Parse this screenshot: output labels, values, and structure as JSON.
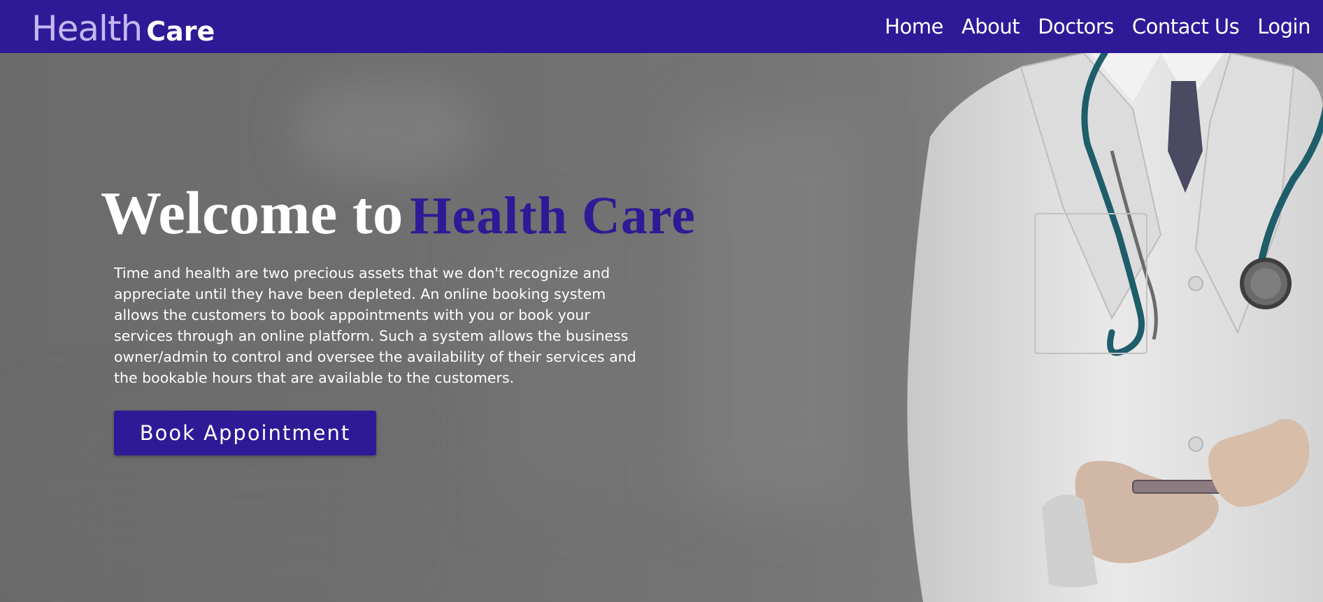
{
  "brand": {
    "light": "Health",
    "bold": "Care"
  },
  "nav": {
    "items": [
      {
        "label": "Home"
      },
      {
        "label": "About"
      },
      {
        "label": "Doctors"
      },
      {
        "label": "Contact Us"
      },
      {
        "label": "Login"
      }
    ]
  },
  "hero": {
    "title_white": "Welcome to",
    "title_accent": "Health Care",
    "description": "Time and health are two precious assets that we don't recognize and appreciate until they have been depleted. An online booking system allows the customers to book appointments with you or book your services through an online platform. Such a system allows the business owner/admin to control and oversee the availability of their services and the bookable hours that are available to the customers.",
    "cta_label": "Book Appointment"
  },
  "colors": {
    "brand": "#2e1a96",
    "brand_light": "#c5b8f2",
    "text": "#ffffff"
  }
}
